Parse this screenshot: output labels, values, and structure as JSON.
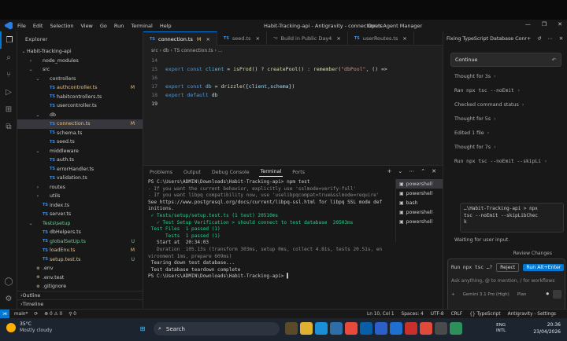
{
  "titlebar": {
    "menu": [
      "File",
      "Edit",
      "Selection",
      "View",
      "Go",
      "Run",
      "Terminal",
      "Help"
    ],
    "title": "Habit-Tracking-api - Antigravity - connection.ts",
    "agent_manager": "Open Agent Manager",
    "controls": [
      "—",
      "❐",
      "✕"
    ]
  },
  "explorer": {
    "header": "Explorer",
    "root": "Habit-Tracking-api",
    "items": [
      {
        "label": "node_modules",
        "depth": 1,
        "kind": "folder",
        "chev": "›"
      },
      {
        "label": "src",
        "depth": 1,
        "kind": "folder",
        "chev": "⌄"
      },
      {
        "label": "controllers",
        "depth": 2,
        "kind": "folder",
        "chev": "⌄"
      },
      {
        "label": "authcontroller.ts",
        "depth": 3,
        "kind": "ts",
        "badge": "M"
      },
      {
        "label": "habitcontrollers.ts",
        "depth": 3,
        "kind": "ts"
      },
      {
        "label": "usercontroller.ts",
        "depth": 3,
        "kind": "ts"
      },
      {
        "label": "db",
        "depth": 2,
        "kind": "folder",
        "chev": "⌄"
      },
      {
        "label": "connection.ts",
        "depth": 3,
        "kind": "ts",
        "badge": "M",
        "selected": true
      },
      {
        "label": "schema.ts",
        "depth": 3,
        "kind": "ts"
      },
      {
        "label": "seed.ts",
        "depth": 3,
        "kind": "ts"
      },
      {
        "label": "middleware",
        "depth": 2,
        "kind": "folder",
        "chev": "⌄"
      },
      {
        "label": "auth.ts",
        "depth": 3,
        "kind": "ts"
      },
      {
        "label": "errorHandler.ts",
        "depth": 3,
        "kind": "ts"
      },
      {
        "label": "validation.ts",
        "depth": 3,
        "kind": "ts"
      },
      {
        "label": "routes",
        "depth": 2,
        "kind": "folder",
        "chev": "›"
      },
      {
        "label": "utils",
        "depth": 2,
        "kind": "folder",
        "chev": "›"
      },
      {
        "label": "index.ts",
        "depth": 2,
        "kind": "ts"
      },
      {
        "label": "server.ts",
        "depth": 2,
        "kind": "ts"
      },
      {
        "label": "Tests\\setup",
        "depth": 1,
        "kind": "folder-g",
        "chev": "⌄"
      },
      {
        "label": "dbHelpers.ts",
        "depth": 2,
        "kind": "ts"
      },
      {
        "label": "globalSetUp.ts",
        "depth": 2,
        "kind": "ts-g",
        "badge": "U"
      },
      {
        "label": "loadEnv.ts",
        "depth": 2,
        "kind": "ts",
        "badge": "M"
      },
      {
        "label": "setup.test.ts",
        "depth": 2,
        "kind": "ts-o",
        "badge": "U"
      },
      {
        "label": ".env",
        "depth": 1,
        "kind": "env"
      },
      {
        "label": ".env.test",
        "depth": 1,
        "kind": "env"
      },
      {
        "label": ".gitignore",
        "depth": 1,
        "kind": "env"
      }
    ],
    "outline": "Outline",
    "timeline": "Timeline"
  },
  "editor": {
    "tabs": [
      {
        "label": "connection.ts",
        "badge": "M",
        "active": true
      },
      {
        "label": "seed.ts"
      },
      {
        "label": "Build in Public Day4"
      },
      {
        "label": "userRoutes.ts"
      }
    ],
    "breadcrumb": "src › db › TS connection.ts › ...",
    "lines": [
      {
        "n": "14",
        "parts": []
      },
      {
        "n": "15",
        "parts": [
          [
            "kw",
            "export "
          ],
          [
            "kw",
            "const "
          ],
          [
            "var",
            "client "
          ],
          [
            "pl",
            "= "
          ],
          [
            "fn",
            "isProd"
          ],
          [
            "pl",
            "() ? "
          ],
          [
            "fn",
            "createPool"
          ],
          [
            "pl",
            "() : "
          ],
          [
            "fn",
            "remember"
          ],
          [
            "pl",
            "("
          ],
          [
            "str",
            "\"dbPool\""
          ],
          [
            "pl",
            ", () =>"
          ]
        ]
      },
      {
        "n": "16",
        "parts": []
      },
      {
        "n": "17",
        "parts": [
          [
            "kw",
            "export "
          ],
          [
            "kw",
            "const "
          ],
          [
            "var",
            "db "
          ],
          [
            "pl",
            "= "
          ],
          [
            "fn",
            "drizzle"
          ],
          [
            "pl",
            "({"
          ],
          [
            "pm",
            "client"
          ],
          [
            "pl",
            ","
          ],
          [
            "pm",
            "schema"
          ],
          [
            "pl",
            "})"
          ]
        ]
      },
      {
        "n": "18",
        "parts": [
          [
            "kw",
            "export "
          ],
          [
            "kw",
            "default "
          ],
          [
            "pm",
            "db"
          ]
        ]
      },
      {
        "n": "19",
        "parts": [],
        "current": true
      }
    ]
  },
  "panel": {
    "tabs": [
      "Problems",
      "Output",
      "Debug Console",
      "Terminal",
      "Ports"
    ],
    "active_tab": "Terminal",
    "actions": [
      "+",
      "⌄",
      "⋯",
      "⌃",
      "✕"
    ],
    "terminal": [
      {
        "t": "PS C:\\Users\\ADMIN\\Downloads\\Habit-Tracking-api> npm test",
        "c": ""
      },
      {
        "t": "- If you want the current behavior, explicitly use 'sslmode=verify-full'",
        "c": "t-dim"
      },
      {
        "t": "- If you want libpq compatibility now, use 'uselibpqcompat=true&sslmode=require'",
        "c": "t-dim"
      },
      {
        "t": "",
        "c": ""
      },
      {
        "t": "See https://www.postgresql.org/docs/current/libpq-ssl.html for libpq SSL mode def",
        "c": ""
      },
      {
        "t": "initions.",
        "c": ""
      },
      {
        "t": " ✓ Tests/setup/setup.test.ts (1 test) 20510ms",
        "c": "t-green"
      },
      {
        "t": "   ✓ Test Setup Verification > should connect to test database  20503ms",
        "c": "t-green"
      },
      {
        "t": "",
        "c": ""
      },
      {
        "t": " Test Files  1 passed (1)",
        "c": "t-green"
      },
      {
        "t": "      Tests  1 passed (1)",
        "c": "t-green"
      },
      {
        "t": "   Start at  20:34:03",
        "c": ""
      },
      {
        "t": "   Duration  105.13s (transform 303ms, setup 0ms, collect 4.81s, tests 20.51s, en",
        "c": "t-dim"
      },
      {
        "t": "vironment 1ms, prepare 609ms)",
        "c": "t-dim"
      },
      {
        "t": "",
        "c": ""
      },
      {
        "t": " Tearing down test database...",
        "c": ""
      },
      {
        "t": " Test database teardown complete",
        "c": ""
      },
      {
        "t": "PS C:\\Users\\ADMIN\\Downloads\\Habit-Tracking-api> ",
        "c": ""
      }
    ],
    "shells": [
      "powershell",
      "powershell",
      "bash",
      "powershell",
      "powershell"
    ]
  },
  "chat": {
    "title": "Fixing TypeScript Database Conr",
    "continue": "Continue",
    "steps": [
      {
        "text": "Thought for 3s"
      },
      {
        "text": "Ran npx tsc --noEmit",
        "mono": true
      },
      {
        "text": "Checked command status"
      },
      {
        "text": "Thought for 5s"
      },
      {
        "text": "Edited 1 file"
      },
      {
        "text": "Thought for 7s"
      },
      {
        "text": "Run npx tsc --noEmit --skipLi",
        "mono": true
      }
    ],
    "command": "…\\Habit-Tracking-api > npx\ntsc --noEmit --skipLibChec\nk",
    "waiting": "Waiting for user input.",
    "review": "Review Changes",
    "run_cmd": "Run npx tsc …?",
    "reject": "Reject",
    "run": "Run",
    "run_shortcut": "Alt+Enter",
    "ask_placeholder": "Ask anything, @ to mention, / for workflows",
    "mode": "+",
    "model": "Gemini 3.1 Pro (High)",
    "plan": "Plan"
  },
  "statusbar": {
    "branch": "main*",
    "sync": "⟳",
    "errors": "⊗ 0 ⚠ 0",
    "ports": "⚲ 0",
    "position": "Ln 10, Col 1",
    "spaces": "Spaces: 4",
    "encoding": "UTF-8",
    "eol": "CRLF",
    "lang": "{} TypeScript",
    "app": "Antigravity - Settings"
  },
  "taskbar": {
    "temp": "35°C",
    "weather": "Mostly cloudy",
    "search_placeholder": "Search",
    "lang": "ENG",
    "region": "INTL",
    "time": "20:36",
    "date": "23/04/2026"
  }
}
